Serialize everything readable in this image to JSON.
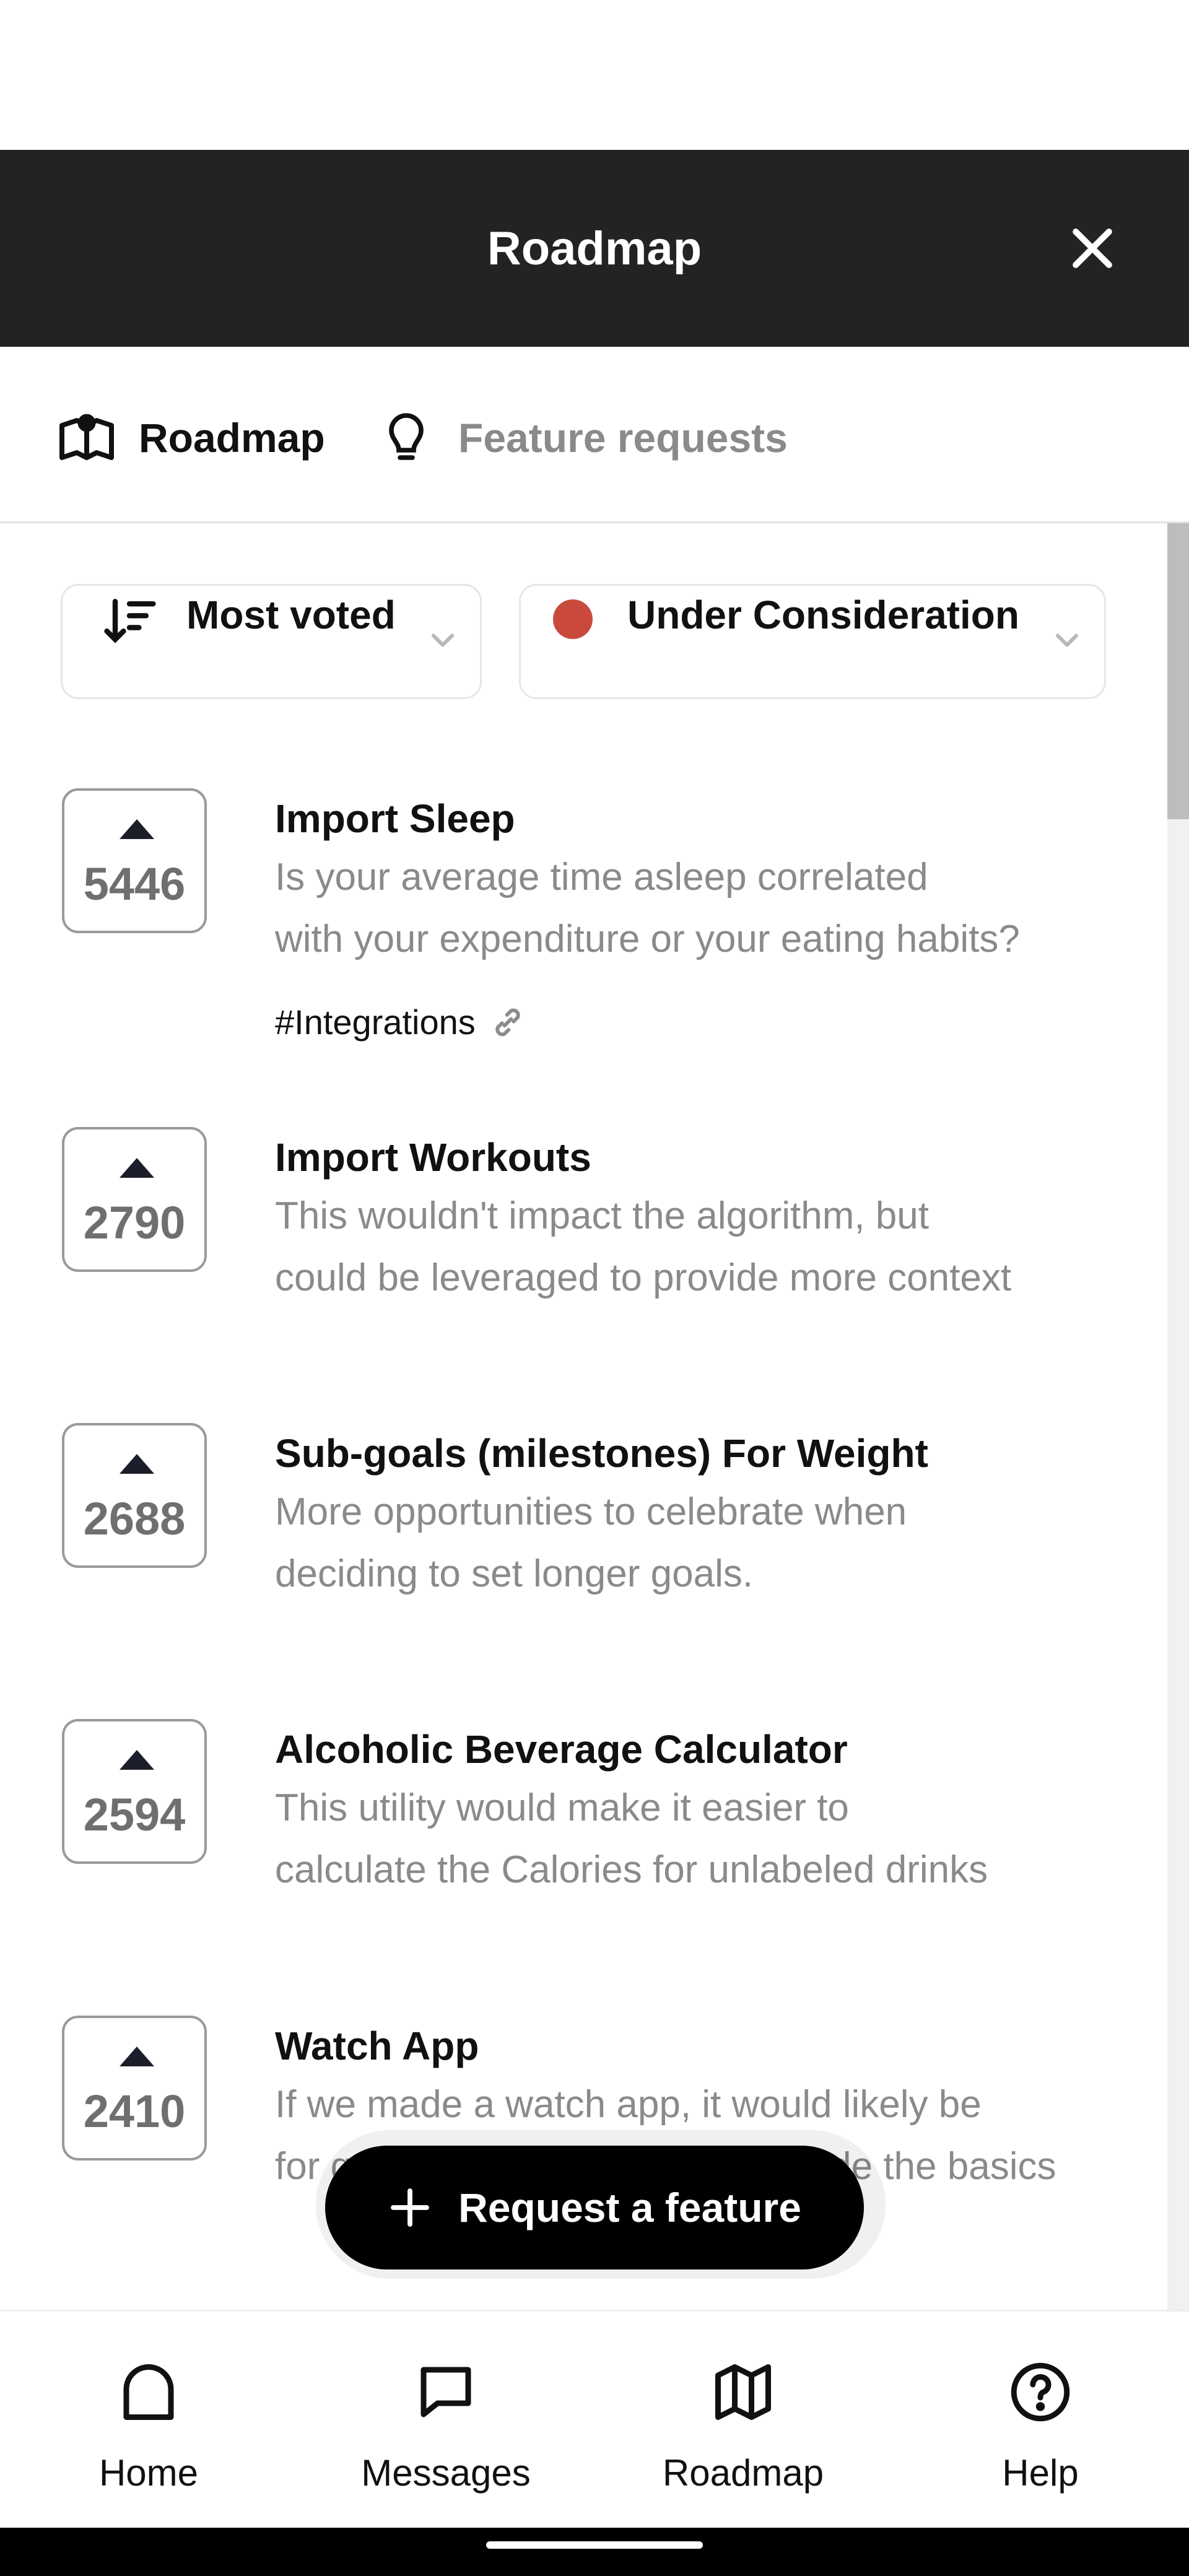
{
  "header": {
    "title": "Roadmap"
  },
  "tabs": [
    {
      "label": "Roadmap",
      "icon": "map-book-icon",
      "active": true
    },
    {
      "label": "Feature requests",
      "icon": "lightbulb-icon",
      "active": false
    }
  ],
  "filters": {
    "sort": {
      "label": "Most voted",
      "icon": "sort-descending-icon"
    },
    "status": {
      "label": "Under Consideration",
      "dot_color": "#c94a3c"
    }
  },
  "features": [
    {
      "votes": "5446",
      "title": "Import Sleep",
      "desc_line1": "Is your average time asleep correlated",
      "desc_line2": "with your expenditure or your eating habits?",
      "tag": "#Integrations"
    },
    {
      "votes": "2790",
      "title": "Import Workouts",
      "desc_line1": "This wouldn't impact the algorithm, but",
      "desc_line2": "could be leveraged to provide more context"
    },
    {
      "votes": "2688",
      "title": "Sub-goals (milestones) For Weight",
      "desc_line1": "More opportunities to celebrate when",
      "desc_line2": "deciding to set longer goals."
    },
    {
      "votes": "2594",
      "title": "Alcoholic Beverage Calculator",
      "desc_line1": "This utility would make it easier to",
      "desc_line2": "calculate the Calories for unlabeled drinks"
    },
    {
      "votes": "2410",
      "title": "Watch App",
      "desc_line1": "If we made a watch app, it would likely be",
      "desc_line2": "for quick logging and would include the basics"
    }
  ],
  "fab": {
    "label": "Request a feature"
  },
  "bottom_nav": [
    {
      "label": "Home",
      "icon": "home-icon"
    },
    {
      "label": "Messages",
      "icon": "chat-bubble-icon"
    },
    {
      "label": "Roadmap",
      "icon": "map-icon"
    },
    {
      "label": "Help",
      "icon": "help-circle-icon"
    }
  ],
  "colors": {
    "header_bg": "#232323",
    "status_dot": "#c94a3c",
    "fab_bg": "#000000"
  }
}
